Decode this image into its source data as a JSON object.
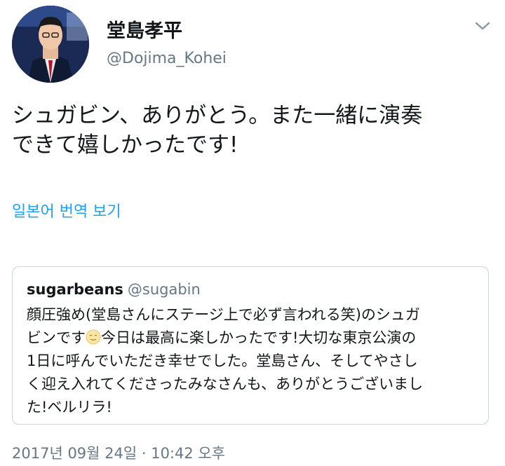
{
  "author": {
    "display_name": "堂島孝平",
    "handle": "@Dojima_Kohei",
    "avatar_icon": "profile-photo"
  },
  "menu": {
    "icon": "chevron-down-icon"
  },
  "tweet": {
    "text_line1": "シュガビン、ありがとう。また一緒に演奏",
    "text_line2": "できて嬉しかったです!",
    "translate_label": "일본어 번역 보기"
  },
  "quote": {
    "name": "sugarbeans",
    "handle": "@sugabin",
    "line1": "顔圧強め(堂島さんにステージ上で必ず言われる笑)のシュガ",
    "line2_a": "ビンです",
    "line2_b": "今日は最高に楽しかったです!大切な東京公演の",
    "line3": "1日に呼んでいただき幸せでした。堂島さん、そしてやさし",
    "line4": "く迎え入れてくださったみなさんも、ありがとうございまし",
    "line5": "た!ベルリラ!",
    "emoji_icon": "smiling-face-emoji"
  },
  "timestamp": "2017년 09월 24일 · 10:42 오후",
  "colors": {
    "link": "#1da1f2",
    "secondary_text": "#657786",
    "primary_text": "#14171a",
    "border": "#ccd6dd"
  }
}
